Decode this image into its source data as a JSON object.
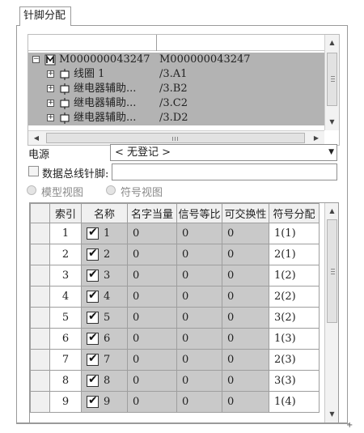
{
  "tab": {
    "label": "针脚分配"
  },
  "tree": {
    "root": {
      "name": "M000000043247",
      "value": "M000000043247"
    },
    "children": [
      {
        "name": "线圈 1",
        "value": "/3.A1"
      },
      {
        "name": "继电器辅助...",
        "value": "/3.B2"
      },
      {
        "name": "继电器辅助...",
        "value": "/3.C2"
      },
      {
        "name": "继电器辅助...",
        "value": "/3.D2"
      }
    ]
  },
  "form": {
    "power_label": "电源",
    "power_value": "< 无登记 >",
    "bus_pin_label": "数据总线针脚:",
    "bus_pin_value": "",
    "model_view_label": "模型视图",
    "symbol_view_label": "符号视图"
  },
  "grid": {
    "columns": [
      "索引",
      "名称",
      "名字当量",
      "信号等比",
      "可交换性",
      "符号分配"
    ],
    "rows": [
      {
        "index": "1",
        "checked": true,
        "name": "1",
        "name_equiv": "0",
        "signal_ratio": "0",
        "swap": "0",
        "symbol": "1(1)"
      },
      {
        "index": "2",
        "checked": true,
        "name": "2",
        "name_equiv": "0",
        "signal_ratio": "0",
        "swap": "0",
        "symbol": "2(1)"
      },
      {
        "index": "3",
        "checked": true,
        "name": "3",
        "name_equiv": "0",
        "signal_ratio": "0",
        "swap": "0",
        "symbol": "1(2)"
      },
      {
        "index": "4",
        "checked": true,
        "name": "4",
        "name_equiv": "0",
        "signal_ratio": "0",
        "swap": "0",
        "symbol": "2(2)"
      },
      {
        "index": "5",
        "checked": true,
        "name": "5",
        "name_equiv": "0",
        "signal_ratio": "0",
        "swap": "0",
        "symbol": "3(2)"
      },
      {
        "index": "6",
        "checked": true,
        "name": "6",
        "name_equiv": "0",
        "signal_ratio": "0",
        "swap": "0",
        "symbol": "1(3)"
      },
      {
        "index": "7",
        "checked": true,
        "name": "7",
        "name_equiv": "0",
        "signal_ratio": "0",
        "swap": "0",
        "symbol": "2(3)"
      },
      {
        "index": "8",
        "checked": true,
        "name": "8",
        "name_equiv": "0",
        "signal_ratio": "0",
        "swap": "0",
        "symbol": "3(3)"
      },
      {
        "index": "9",
        "checked": true,
        "name": "9",
        "name_equiv": "0",
        "signal_ratio": "0",
        "swap": "0",
        "symbol": "1(4)"
      }
    ]
  },
  "icons": {
    "tree_expander": "plus-box-icon",
    "device_node": "device-icon",
    "coil_node": "coil-icon",
    "dropdown": "chevron-down-icon"
  },
  "colors": {
    "selected_row": "#b3b3b3",
    "readonly_cell": "#c9c9c9"
  }
}
